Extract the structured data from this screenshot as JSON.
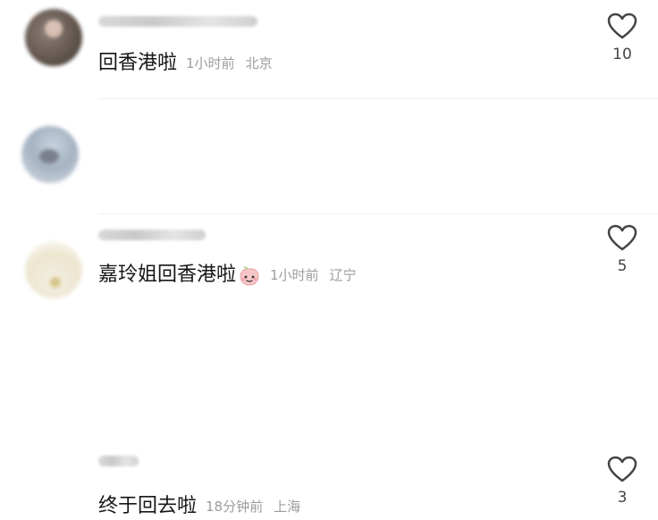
{
  "comments": [
    {
      "text": "回香港啦",
      "time": "1小时前",
      "location": "北京",
      "likes": "10"
    },
    {
      "text": "嘉玲姐回香港啦",
      "emoji": "peach-emoji",
      "time": "1小时前",
      "location": "辽宁",
      "likes": "5"
    },
    {
      "text": "终于回去啦",
      "time": "18分钟前",
      "location": "上海",
      "likes": "3"
    }
  ],
  "icons": {
    "like": "heart-outline-icon",
    "emoji": "peach-emoji-icon"
  },
  "colors": {
    "text_primary": "#161616",
    "text_meta": "#9c9c9c",
    "like_count": "#444444",
    "divider": "#f0f0f0",
    "heart_stroke": "#444444"
  }
}
